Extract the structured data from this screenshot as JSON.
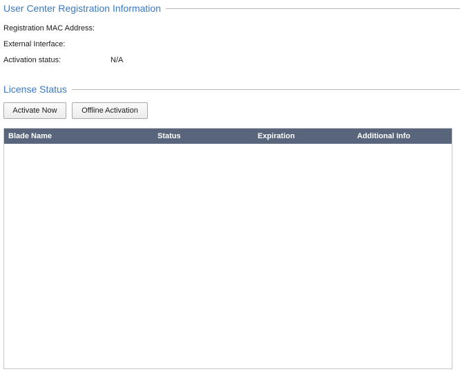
{
  "registration": {
    "title": "User Center Registration Information",
    "fields": [
      {
        "label": "Registration MAC Address:",
        "value": ""
      },
      {
        "label": "External Interface:",
        "value": ""
      },
      {
        "label": "Activation status:",
        "value": "N/A"
      }
    ]
  },
  "license": {
    "title": "License Status",
    "buttons": {
      "activate_now": "Activate Now",
      "offline_activation": "Offline Activation"
    },
    "table": {
      "columns": [
        "Blade Name",
        "Status",
        "Expiration",
        "Additional Info"
      ],
      "rows": []
    }
  },
  "colors": {
    "section_title": "#3a78c2",
    "table_header_bg": "#59657a",
    "table_header_text": "#ffffff"
  }
}
